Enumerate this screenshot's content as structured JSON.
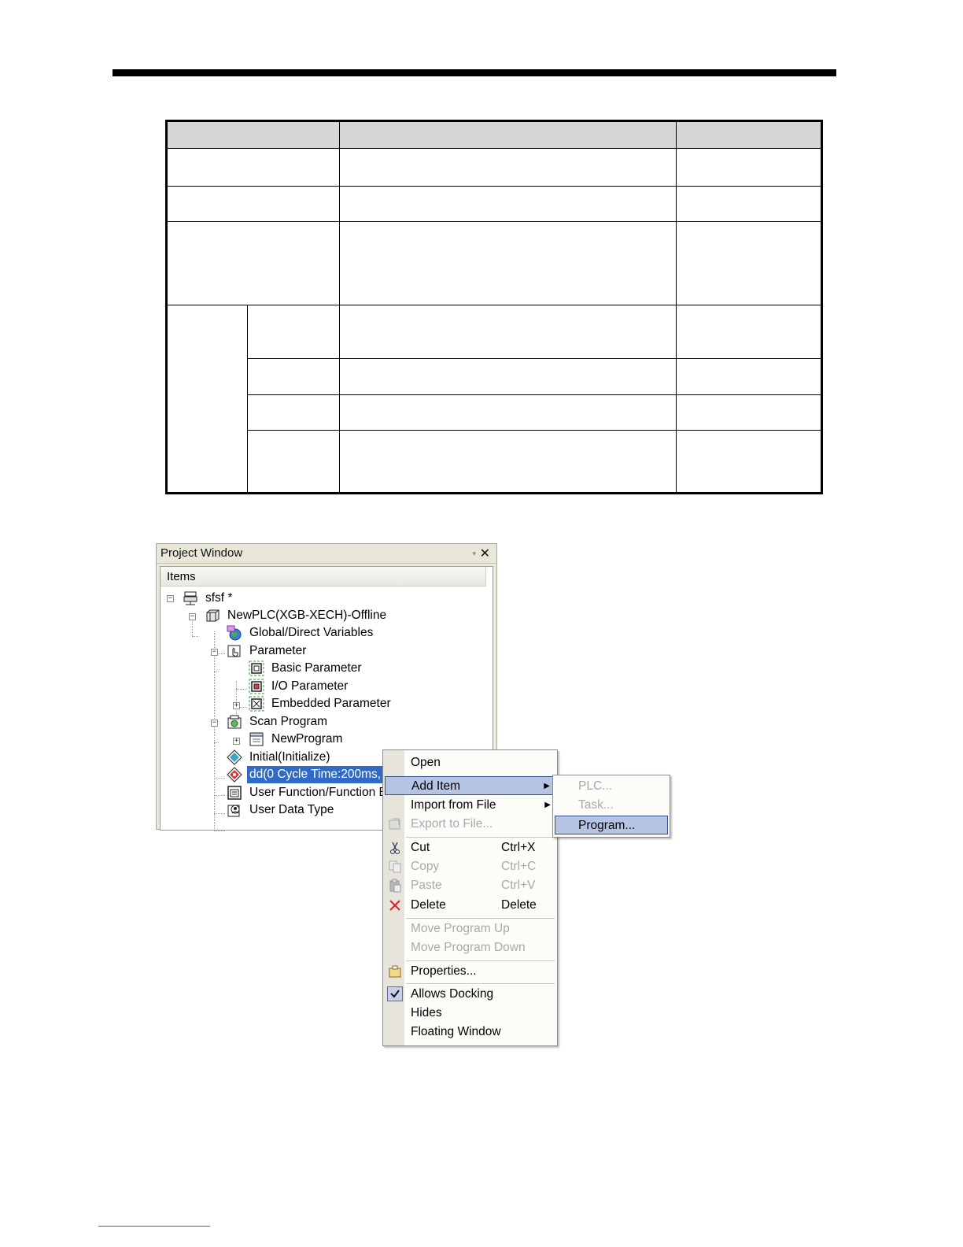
{
  "project_window": {
    "title": "Project Window",
    "dropdown_icon": "▾",
    "close_icon": "✕",
    "items_header": "Items",
    "tree": [
      {
        "label": "sfsf *",
        "icon": "project-icon"
      },
      {
        "label": "NewPLC(XGB-XECH)-Offline",
        "icon": "plc-icon"
      },
      {
        "label": "Global/Direct Variables",
        "icon": "globe-variables-icon"
      },
      {
        "label": "Parameter",
        "icon": "parameter-icon"
      },
      {
        "label": "Basic Parameter",
        "icon": "basic-parameter-icon"
      },
      {
        "label": "I/O Parameter",
        "icon": "io-parameter-icon"
      },
      {
        "label": "Embedded Parameter",
        "icon": "embedded-parameter-icon"
      },
      {
        "label": "Scan Program",
        "icon": "scan-program-icon"
      },
      {
        "label": "NewProgram",
        "icon": "program-icon"
      },
      {
        "label": "Initial(Initialize)",
        "icon": "initial-task-icon"
      },
      {
        "label": "dd(0 Cycle Time:200ms, P",
        "icon": "cycle-task-icon"
      },
      {
        "label": "User Function/Function B",
        "icon": "user-function-icon"
      },
      {
        "label": "User Data Type",
        "icon": "user-data-type-icon"
      }
    ]
  },
  "context_menu": {
    "items": [
      {
        "label": "Open"
      },
      {
        "label": "Add Item"
      },
      {
        "label": "Import from File"
      },
      {
        "label": "Export to File..."
      },
      {
        "label": "Cut",
        "shortcut": "Ctrl+X"
      },
      {
        "label": "Copy",
        "shortcut": "Ctrl+C"
      },
      {
        "label": "Paste",
        "shortcut": "Ctrl+V"
      },
      {
        "label": "Delete",
        "shortcut": "Delete"
      },
      {
        "label": "Move Program Up"
      },
      {
        "label": "Move Program Down"
      },
      {
        "label": "Properties..."
      },
      {
        "label": "Allows Docking"
      },
      {
        "label": "Hides"
      },
      {
        "label": "Floating Window"
      }
    ]
  },
  "submenu": {
    "items": [
      {
        "label": "PLC..."
      },
      {
        "label": "Task..."
      },
      {
        "label": "Program..."
      }
    ]
  },
  "colors": {
    "selection": "#316ac5",
    "menu_highlight": "#b6c4e4",
    "disabled_text": "#a9a9a9"
  }
}
